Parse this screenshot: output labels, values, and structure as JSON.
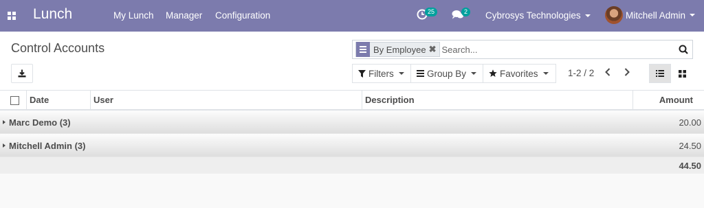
{
  "navbar": {
    "app_name": "Lunch",
    "menu": [
      "My Lunch",
      "Manager",
      "Configuration"
    ],
    "activity_count": "25",
    "message_count": "2",
    "company": "Cybrosys Technologies",
    "user": "Mitchell Admin",
    "color": "#7c7bad"
  },
  "control_panel": {
    "breadcrumb": "Control Accounts",
    "search": {
      "facet": "By Employee",
      "placeholder": "Search..."
    },
    "filters_label": "Filters",
    "groupby_label": "Group By",
    "favorites_label": "Favorites",
    "pager": "1-2 / 2"
  },
  "table": {
    "columns": [
      "Date",
      "User",
      "Description",
      "Amount"
    ],
    "groups": [
      {
        "name": "Marc Demo (3)",
        "amount": "20.00"
      },
      {
        "name": "Mitchell Admin (3)",
        "amount": "24.50"
      }
    ],
    "total": "44.50"
  }
}
